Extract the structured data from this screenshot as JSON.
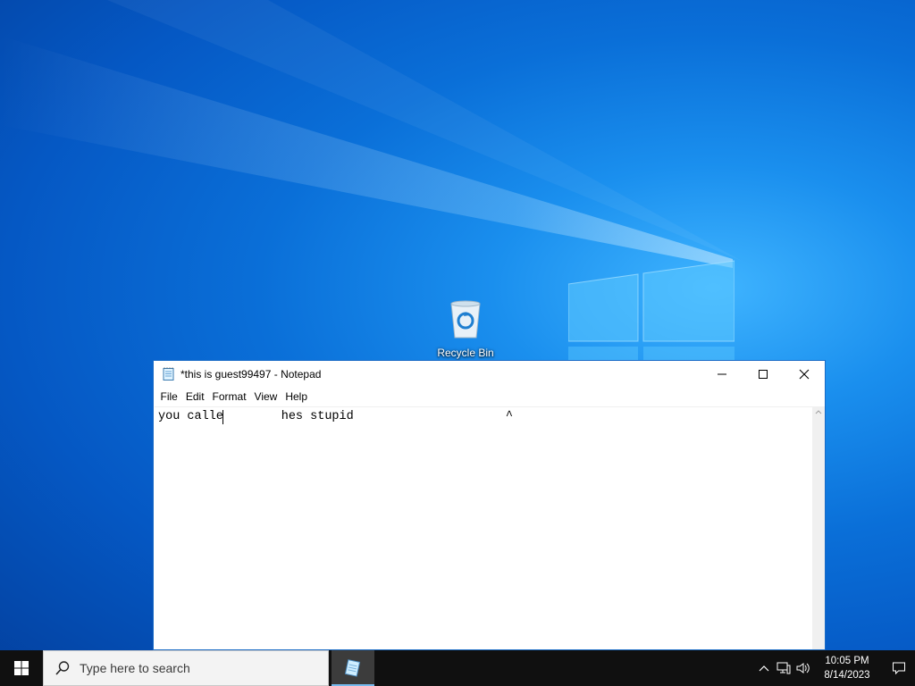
{
  "desktop": {
    "icons": [
      {
        "label": "Recycle Bin",
        "icon": "recycle-bin-icon"
      }
    ]
  },
  "notepad": {
    "title": "*this is guest99497 - Notepad",
    "menu": [
      "File",
      "Edit",
      "Format",
      "View",
      "Help"
    ],
    "content": "you calle        hes stupid                     ^",
    "controls": [
      "minimize-icon",
      "maximize-icon",
      "close-icon"
    ]
  },
  "taskbar": {
    "search_placeholder": "Type here to search",
    "time": "10:05 PM",
    "date": "8/14/2023",
    "accent": "#76b9ed"
  }
}
